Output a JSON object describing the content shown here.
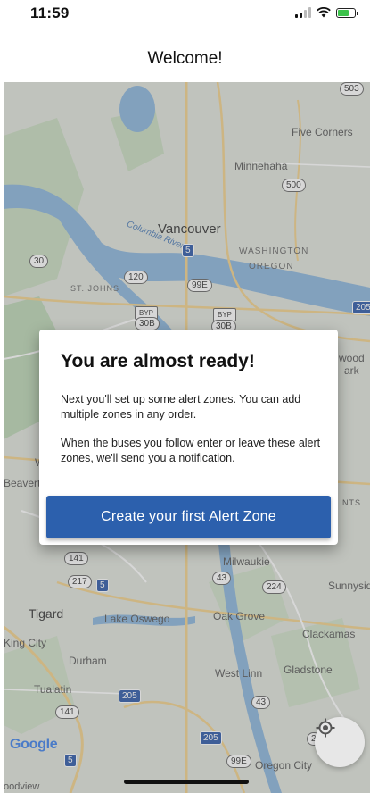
{
  "status": {
    "time": "11:59"
  },
  "header": {
    "title": "Welcome!"
  },
  "map": {
    "labels": {
      "vancouver": "Vancouver",
      "five_corners": "Five Corners",
      "minnehaha": "Minnehaha",
      "columbia_river": "Columbia River",
      "washington": "WASHINGTON",
      "oregon": "OREGON",
      "st_johns": "ST. JOHNS",
      "beaverton": "Beavert",
      "wood": "wood",
      "ark": "ark",
      "milwaukie": "Milwaukie",
      "sunnyside": "Sunnysid",
      "tigard": "Tigard",
      "lake_oswego": "Lake Oswego",
      "oak_grove": "Oak Grove",
      "clackamas": "Clackamas",
      "king_city": "King City",
      "durham": "Durham",
      "west_linn": "West Linn",
      "gladstone": "Gladstone",
      "tualatin": "Tualatin",
      "oregon_city": "Oregon City",
      "woodview": "oodview",
      "nts": "NTS",
      "w": "W"
    },
    "shields": {
      "s503": "503",
      "s500": "500",
      "s5a": "5",
      "s30": "30",
      "s120": "120",
      "s99e": "99E",
      "byp1": "BYP",
      "s30b1": "30B",
      "byp2": "BYP",
      "s30b2": "30B",
      "s205a": "205",
      "s141a": "141",
      "s217": "217",
      "s5b": "5",
      "s43a": "43",
      "s224": "224",
      "s205b": "205",
      "s43b": "43",
      "s141b": "141",
      "s205c": "205",
      "s99e2": "99E",
      "s5c": "5",
      "s2": "2"
    },
    "attribution": "Google",
    "locate_icon": "crosshair-locate-icon"
  },
  "dialog": {
    "title": "You are almost ready!",
    "paragraph1": "Next you'll set up some alert zones. You can add multiple zones in any order.",
    "paragraph2": "When the buses you follow enter or leave these alert zones, we'll send you a notification.",
    "cta_label": "Create your first Alert Zone"
  },
  "colors": {
    "primary": "#2c60ad",
    "water": "#8ab4dc",
    "land": "#dfe3dc"
  }
}
